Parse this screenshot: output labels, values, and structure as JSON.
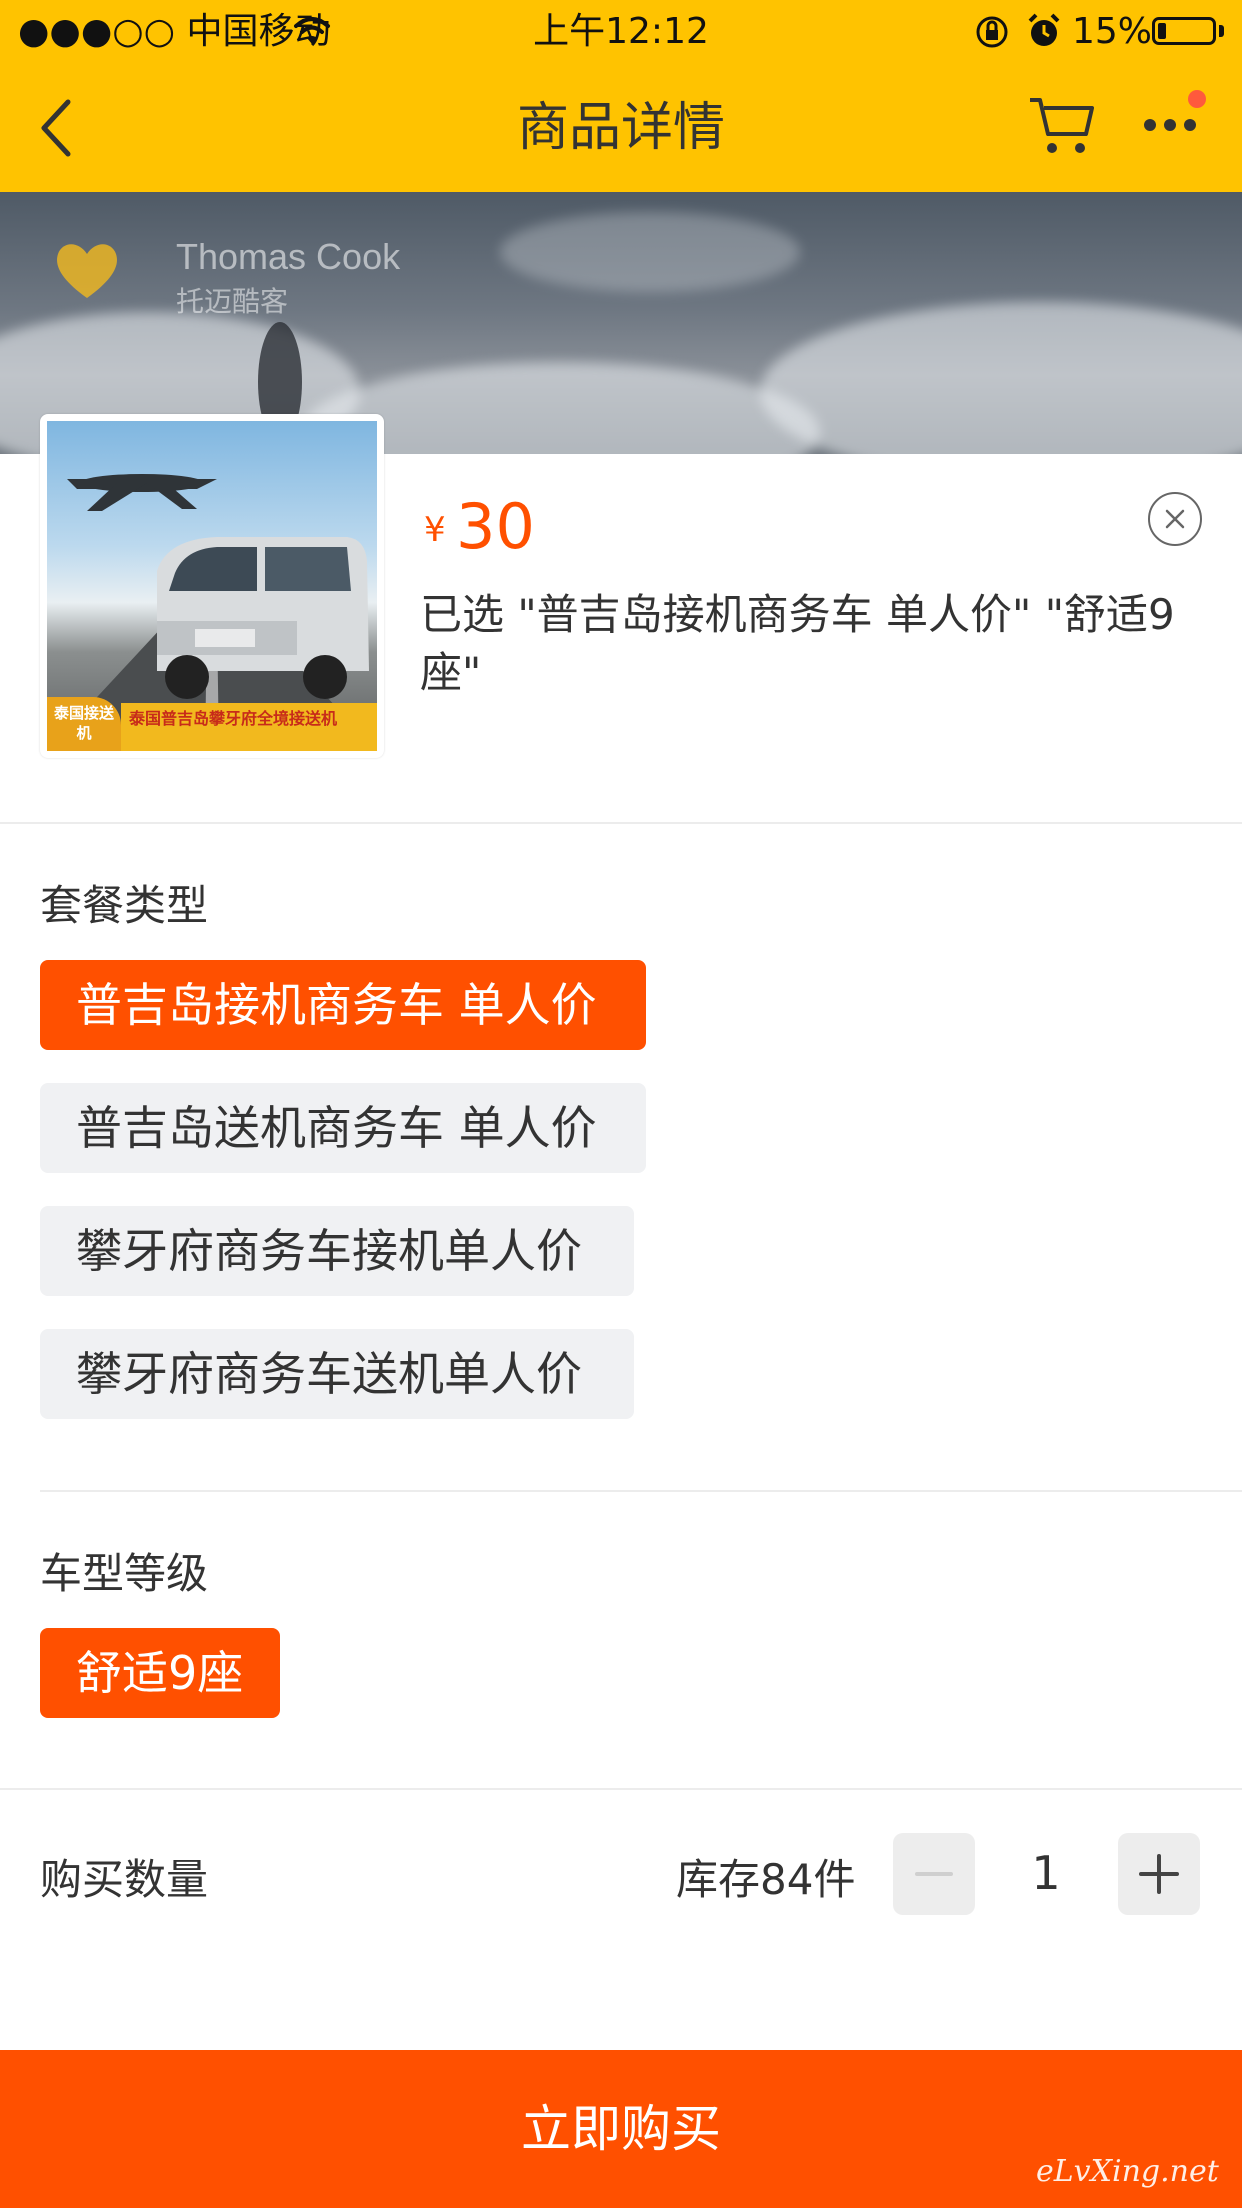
{
  "status_bar": {
    "carrier": "●●●○○ 中国移动",
    "time": "上午12:12",
    "battery": "15%",
    "battery_level": 0.15
  },
  "nav": {
    "title": "商品详情"
  },
  "banner": {
    "brand": "Thomas Cook",
    "brand_cn": "托迈酷客"
  },
  "product": {
    "thumb_tag": "泰国接送机",
    "thumb_caption": "泰国普吉岛攀牙府全境接送机",
    "currency": "¥",
    "price": "30",
    "selected": "已选 \"普吉岛接机商务车 单人价\" \"舒适9座\""
  },
  "package_section": {
    "title": "套餐类型",
    "options": [
      {
        "label": "普吉岛接机商务车 单人价",
        "active": true
      },
      {
        "label": "普吉岛送机商务车 单人价",
        "active": false
      },
      {
        "label": "攀牙府商务车接机单人价",
        "active": false
      },
      {
        "label": "攀牙府商务车送机单人价",
        "active": false
      }
    ]
  },
  "car_section": {
    "title": "车型等级",
    "options": [
      {
        "label": "舒适9座",
        "active": true
      }
    ]
  },
  "quantity": {
    "label": "购买数量",
    "stock": "库存84件",
    "value": "1"
  },
  "buy_button": {
    "label": "立即购买"
  },
  "watermark": "eLvXing.net",
  "colors": {
    "header": "#FFC300",
    "accent": "#FF5000"
  }
}
